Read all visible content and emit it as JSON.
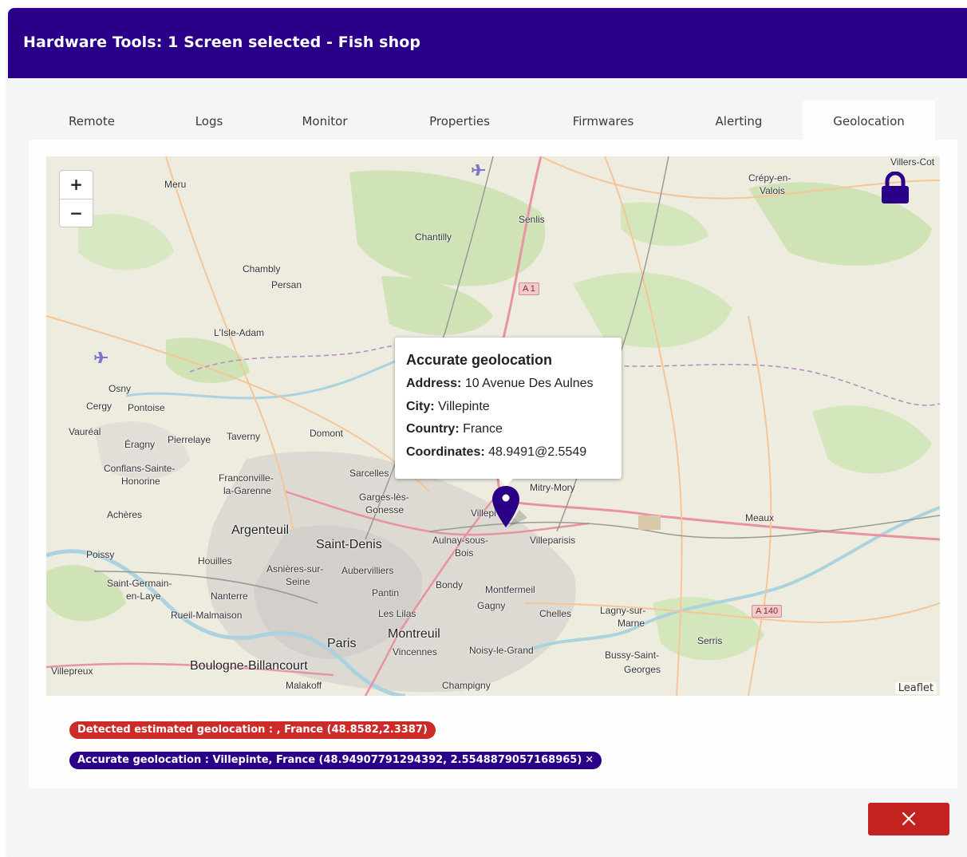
{
  "header": {
    "title": "Hardware Tools: 1 Screen selected - Fish shop"
  },
  "tabs": [
    {
      "label": "Remote"
    },
    {
      "label": "Logs"
    },
    {
      "label": "Monitor"
    },
    {
      "label": "Properties"
    },
    {
      "label": "Firmwares"
    },
    {
      "label": "Alerting"
    },
    {
      "label": "Geolocation"
    }
  ],
  "active_tab": "Geolocation",
  "map": {
    "zoom_in": "+",
    "zoom_out": "−",
    "attribution": "Leaflet",
    "lock_icon": "lock-icon",
    "marker_icon": "map-pin-icon",
    "labels": {
      "meru": "Meru",
      "chantilly": "Chantilly",
      "senlis": "Senlis",
      "crepy": "Crépy-en-",
      "valois": "Valois",
      "villers": "Villers-Cot",
      "chambly": "Chambly",
      "persan": "Persan",
      "lisle": "L'Isle-Adam",
      "a1": "A 1",
      "osny": "Osny",
      "cergy": "Cergy",
      "pontoise": "Pontoise",
      "vauréal": "Vauréal",
      "eragny": "Éragny",
      "pierrelaye": "Pierrelaye",
      "taverny": "Taverny",
      "domont": "Domont",
      "conflans": "Conflans-Sainte-",
      "honorine": "Honorine",
      "franconville": "Franconville-",
      "garenne": "la-Garenne",
      "sarcelles": "Sarcelles",
      "garges": "Garges-lès-",
      "gonesse": "Gonesse",
      "achères": "Achères",
      "argenteuil": "Argenteuil",
      "saintdenis": "Saint-Denis",
      "aulnay": "Aulnay-sous-",
      "bois": "Bois",
      "villeparisis": "Villeparisis",
      "mitry": "Mitry-Mory",
      "meaux": "Meaux",
      "poissy": "Poissy",
      "houilles": "Houilles",
      "asnieres": "Asnières-sur-",
      "seine": "Seine",
      "aubervilliers": "Aubervilliers",
      "bondy": "Bondy",
      "montfermeil": "Montfermeil",
      "stgermain": "Saint-Germain-",
      "enlaye": "en-Laye",
      "nanterre": "Nanterre",
      "pantin": "Pantin",
      "gagny": "Gagny",
      "chelles": "Chelles",
      "lagny": "Lagny-sur-",
      "marne": "Marne",
      "a140": "A 140",
      "rueil": "Rueil-Malmaison",
      "leslilas": "Les Lilas",
      "montreuil": "Montreuil",
      "paris": "Paris",
      "vincennes": "Vincennes",
      "noisy": "Noisy-le-Grand",
      "serris": "Serris",
      "bussy": "Bussy-Saint-",
      "georges": "Georges",
      "villepreux": "Villepreux",
      "boulogne": "Boulogne-Billancourt",
      "malakoff": "Malakoff",
      "champigny": "Champigny",
      "villepinte_short": "Villepi"
    }
  },
  "popup": {
    "title": "Accurate geolocation",
    "address_label": "Address:",
    "address": "10 Avenue Des Aulnes",
    "city_label": "City:",
    "city": "Villepinte",
    "country_label": "Country:",
    "country": "France",
    "coords_label": "Coordinates:",
    "coords": "48.9491@2.5549"
  },
  "badges": {
    "estimated": "Detected estimated geolocation : , France (48.8582,2.3387)",
    "accurate": "Accurate geolocation :  Villepinte, France (48.94907791294392, 2.5548879057168965)",
    "accurate_remove": "✕"
  },
  "footer": {
    "close_icon": "close-icon"
  },
  "colors": {
    "header": "#290087",
    "danger": "#c4221f",
    "badge_red": "#cc2b27"
  }
}
